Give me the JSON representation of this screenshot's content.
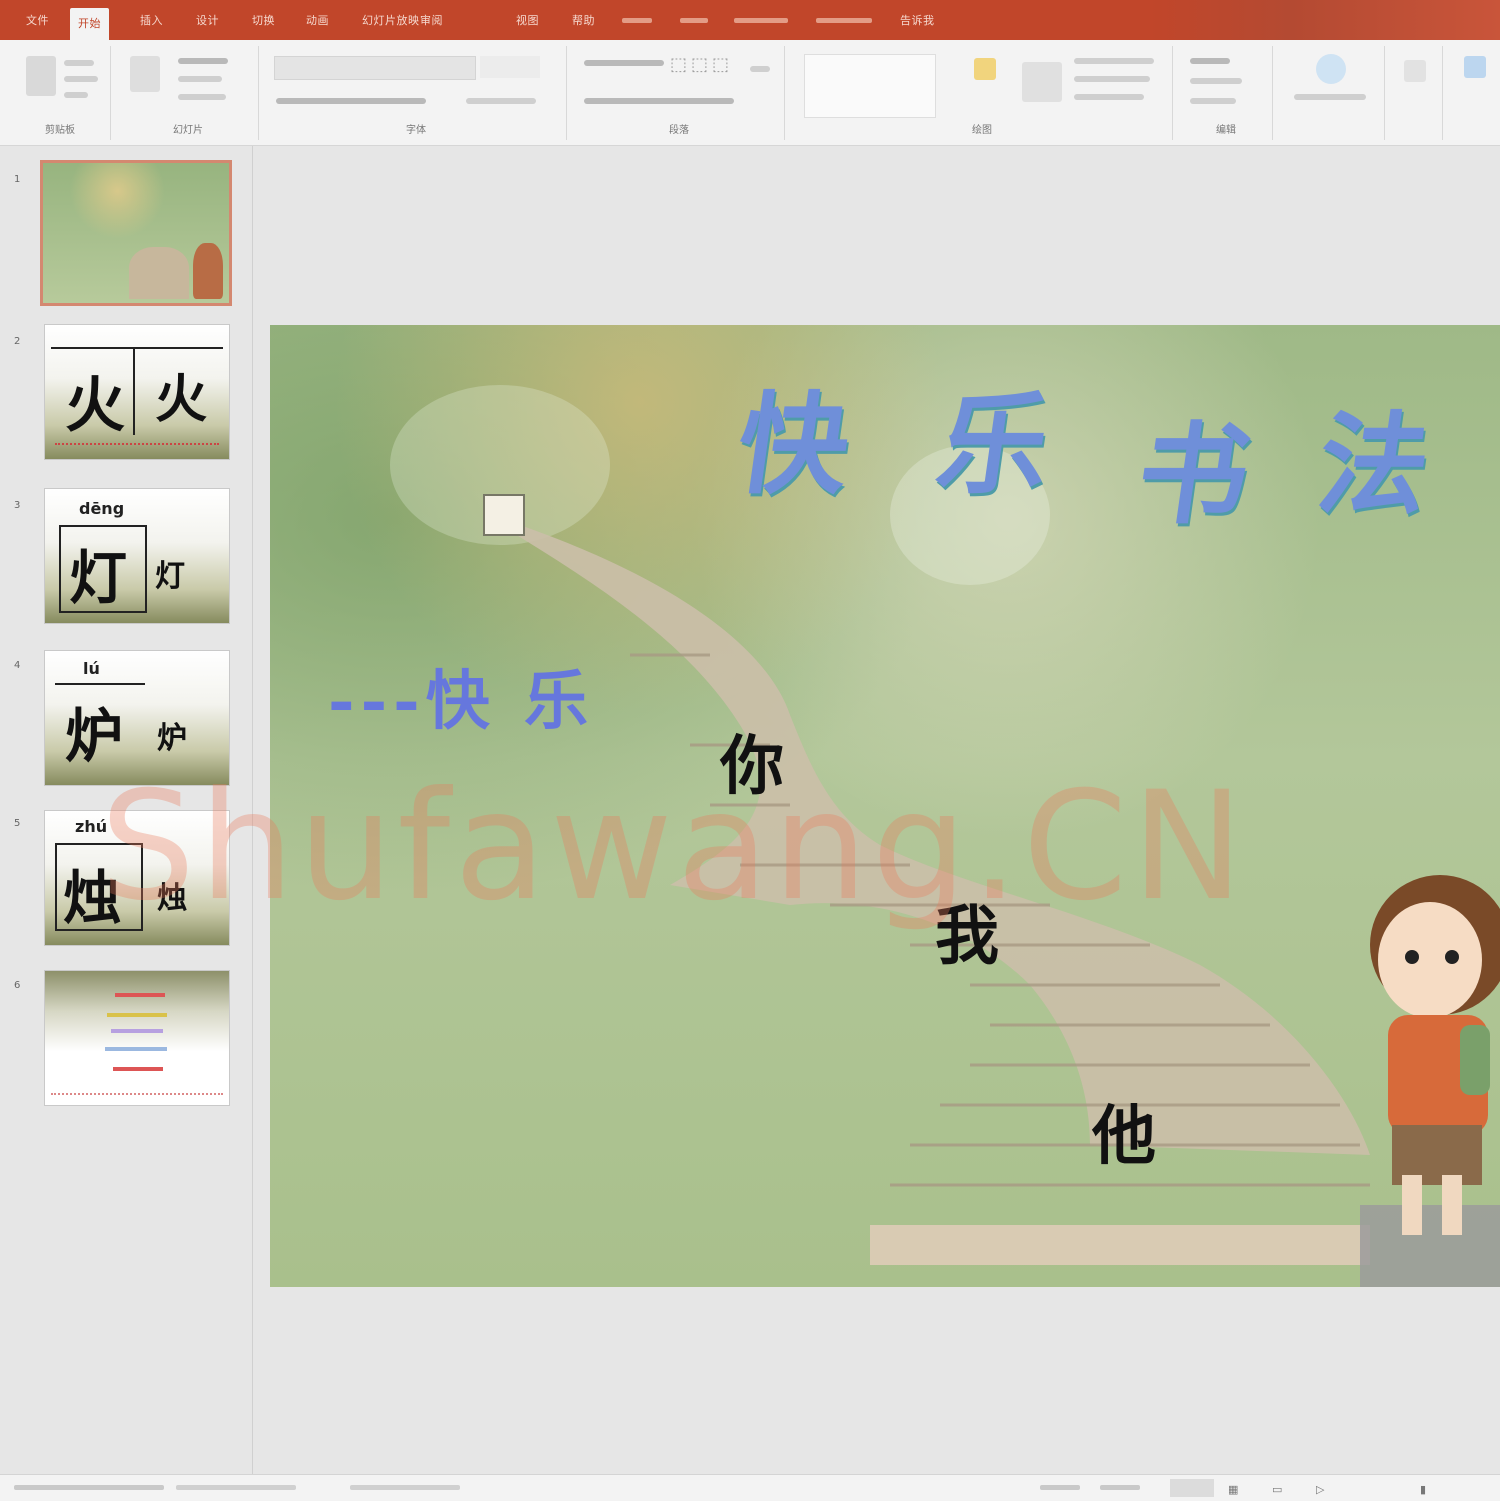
{
  "ribbon": {
    "tabs": [
      "文件",
      "开始",
      "插入",
      "设计",
      "切换",
      "动画",
      "幻灯片放映",
      "审阅",
      "视图",
      "帮助",
      "告诉我"
    ],
    "active_tab_index": 1,
    "groups": [
      "剪贴板",
      "幻灯片",
      "字体",
      "段落",
      "绘图",
      "编辑"
    ]
  },
  "slides_panel": {
    "slides": [
      {
        "number": "1"
      },
      {
        "number": "2",
        "chars": [
          "火",
          "火"
        ]
      },
      {
        "number": "3",
        "pinyin": "dēng",
        "chars": [
          "灯",
          "灯"
        ]
      },
      {
        "number": "4",
        "pinyin": "lú",
        "chars": [
          "炉",
          "炉"
        ]
      },
      {
        "number": "5",
        "pinyin": "zhú",
        "chars": [
          "烛",
          "烛"
        ]
      },
      {
        "number": "6"
      }
    ],
    "selected_index": 0
  },
  "slide": {
    "title_chars": [
      "快",
      "乐",
      "书",
      "法"
    ],
    "subtitle": "---快 乐",
    "stair_chars": [
      "你",
      "我",
      "他"
    ]
  },
  "watermark": "Shufawang.CN",
  "colors": {
    "accent": "#c1462a",
    "title": "#6f8fd9",
    "subtitle": "#6677dd",
    "watermark": "#eb785a"
  }
}
